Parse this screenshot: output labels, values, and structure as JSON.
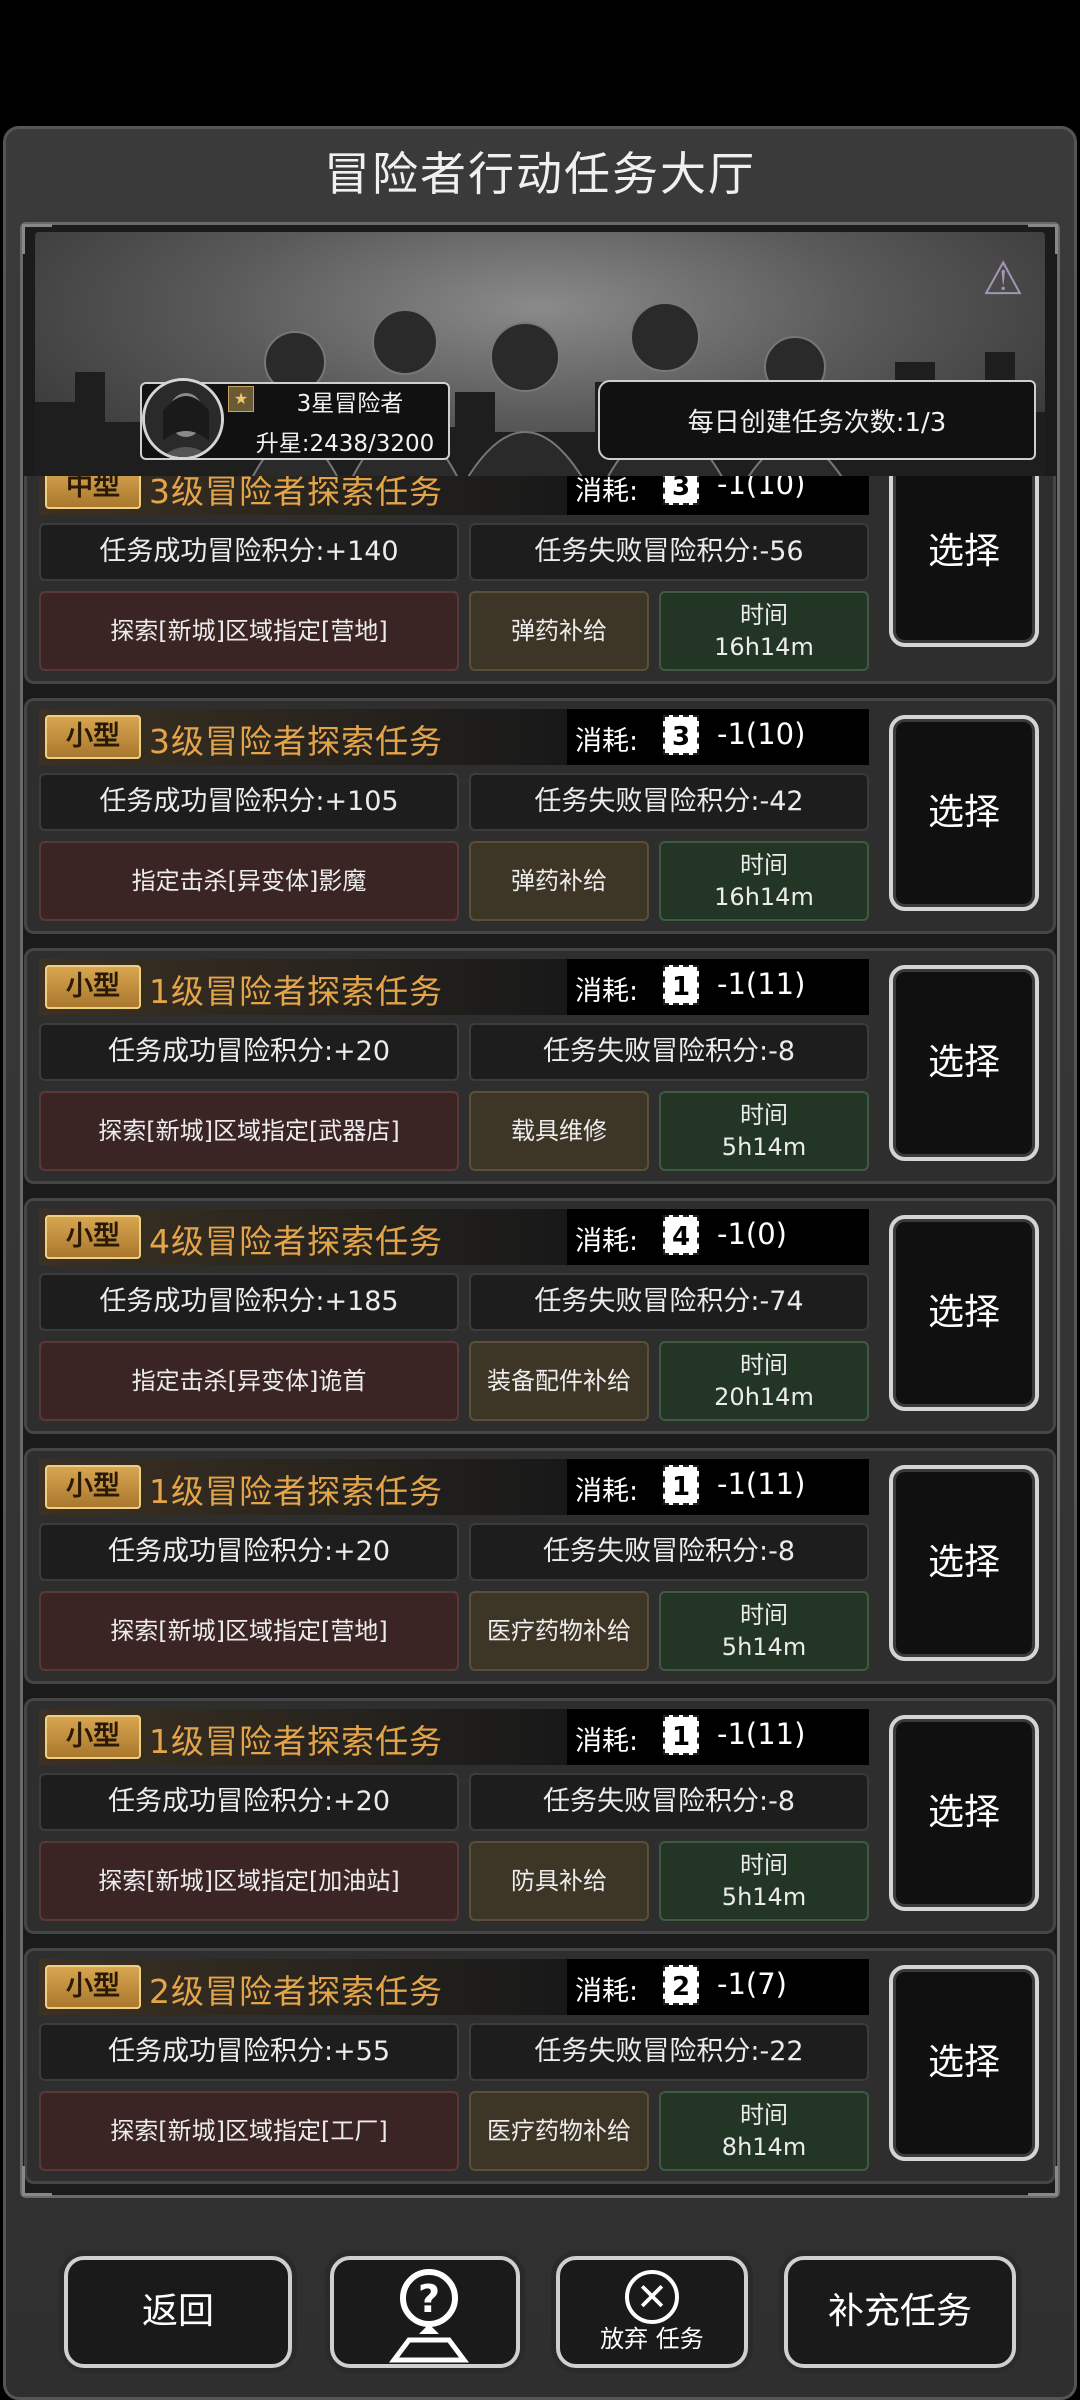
{
  "header": {
    "title": "冒险者行动任务大厅"
  },
  "banner": {
    "rank_name": "3星冒险者",
    "upgrade_progress": "升星:2438/3200",
    "daily_create": "每日创建任务次数:1/3",
    "emblem_icon": "faction-emblem-icon"
  },
  "cost_label": "消耗:",
  "select_label": "选择",
  "time_label": "时间",
  "tasks": [
    {
      "size": "中型",
      "name": "3级冒险者探索任务",
      "cost_level": "3",
      "cost_value": "-1(10)",
      "success": "任务成功冒险积分:+140",
      "fail": "任务失败冒险积分:-56",
      "target": "探索[新城]区域指定[营地]",
      "reward": "弹药补给",
      "time": "16h14m"
    },
    {
      "size": "小型",
      "name": "3级冒险者探索任务",
      "cost_level": "3",
      "cost_value": "-1(10)",
      "success": "任务成功冒险积分:+105",
      "fail": "任务失败冒险积分:-42",
      "target": "指定击杀[异变体]影魔",
      "reward": "弹药补给",
      "time": "16h14m"
    },
    {
      "size": "小型",
      "name": "1级冒险者探索任务",
      "cost_level": "1",
      "cost_value": "-1(11)",
      "success": "任务成功冒险积分:+20",
      "fail": "任务失败冒险积分:-8",
      "target": "探索[新城]区域指定[武器店]",
      "reward": "载具维修",
      "time": "5h14m"
    },
    {
      "size": "小型",
      "name": "4级冒险者探索任务",
      "cost_level": "4",
      "cost_value": "-1(0)",
      "success": "任务成功冒险积分:+185",
      "fail": "任务失败冒险积分:-74",
      "target": "指定击杀[异变体]诡首",
      "reward": "装备配件补给",
      "time": "20h14m"
    },
    {
      "size": "小型",
      "name": "1级冒险者探索任务",
      "cost_level": "1",
      "cost_value": "-1(11)",
      "success": "任务成功冒险积分:+20",
      "fail": "任务失败冒险积分:-8",
      "target": "探索[新城]区域指定[营地]",
      "reward": "医疗药物补给",
      "time": "5h14m"
    },
    {
      "size": "小型",
      "name": "1级冒险者探索任务",
      "cost_level": "1",
      "cost_value": "-1(11)",
      "success": "任务成功冒险积分:+20",
      "fail": "任务失败冒险积分:-8",
      "target": "探索[新城]区域指定[加油站]",
      "reward": "防具补给",
      "time": "5h14m"
    },
    {
      "size": "小型",
      "name": "2级冒险者探索任务",
      "cost_level": "2",
      "cost_value": "-1(7)",
      "success": "任务成功冒险积分:+55",
      "fail": "任务失败冒险积分:-22",
      "target": "探索[新城]区域指定[工厂]",
      "reward": "医疗药物补给",
      "time": "8h14m"
    }
  ],
  "bottom": {
    "back_label": "返回",
    "help_icon": "question-icon",
    "abandon_label": "放弃 任务",
    "supply_label": "补充任务"
  }
}
